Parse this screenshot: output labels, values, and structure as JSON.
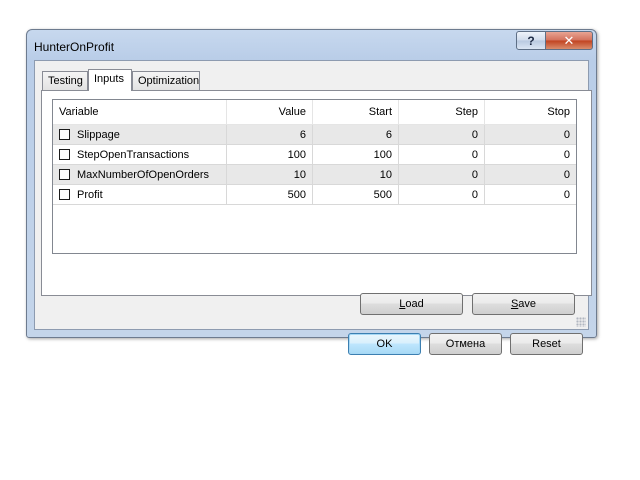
{
  "window": {
    "title": "HunterOnProfit",
    "help_label": "?",
    "close_label": "✕"
  },
  "tabs": [
    {
      "label": "Testing",
      "active": false
    },
    {
      "label": "Inputs",
      "active": true
    },
    {
      "label": "Optimization",
      "active": false
    }
  ],
  "grid": {
    "columns": [
      "Variable",
      "Value",
      "Start",
      "Step",
      "Stop"
    ],
    "rows": [
      {
        "checked": false,
        "variable": "Slippage",
        "value": "6",
        "start": "6",
        "step": "0",
        "stop": "0"
      },
      {
        "checked": false,
        "variable": "StepOpenTransactions",
        "value": "100",
        "start": "100",
        "step": "0",
        "stop": "0"
      },
      {
        "checked": false,
        "variable": "MaxNumberOfOpenOrders",
        "value": "10",
        "start": "10",
        "step": "0",
        "stop": "0"
      },
      {
        "checked": false,
        "variable": "Profit",
        "value": "500",
        "start": "500",
        "step": "0",
        "stop": "0"
      }
    ]
  },
  "panel_buttons": {
    "load_mnemonic": "L",
    "load_rest": "oad",
    "save_mnemonic": "S",
    "save_rest": "ave"
  },
  "dialog_buttons": {
    "ok": "OK",
    "cancel": "Отмена",
    "reset": "Reset"
  }
}
